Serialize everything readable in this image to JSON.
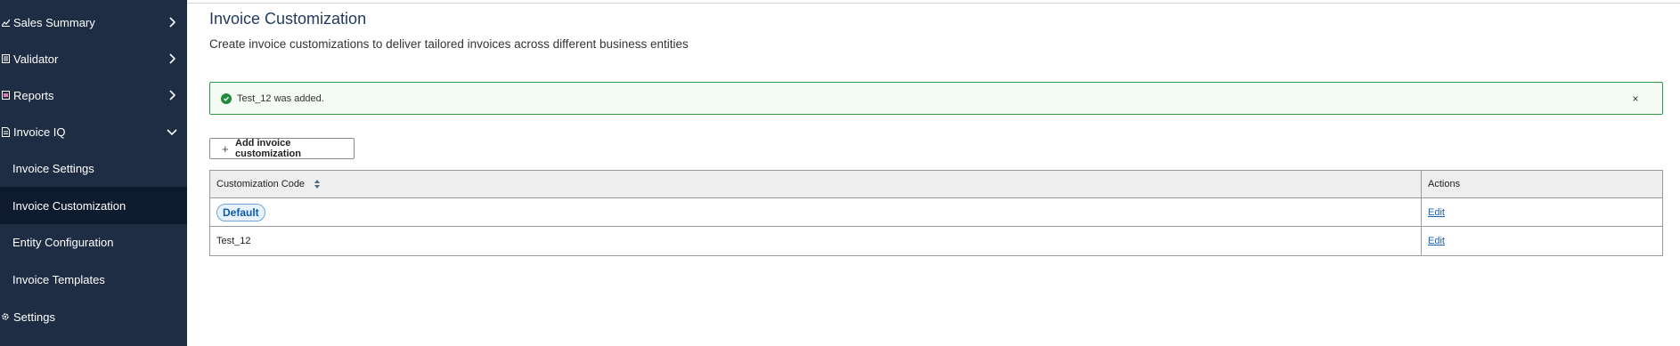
{
  "sidebar": {
    "items": [
      {
        "label": "Sales Summary",
        "icon": "chart-icon"
      },
      {
        "label": "Validator",
        "icon": "validator-icon"
      },
      {
        "label": "Reports",
        "icon": "reports-icon"
      },
      {
        "label": "Invoice IQ",
        "icon": "invoice-icon"
      },
      {
        "label": "Invoice Settings"
      },
      {
        "label": "Invoice Customization"
      },
      {
        "label": "Entity Configuration"
      },
      {
        "label": "Invoice Templates"
      },
      {
        "label": "Settings",
        "icon": "gear-icon"
      }
    ],
    "active_item": "Invoice Customization"
  },
  "main": {
    "title": "Invoice Customization",
    "subtitle": "Create invoice customizations to deliver tailored invoices across different business entities",
    "alert": {
      "message": "Test_12 was added.",
      "close_glyph": "×",
      "status": "success"
    },
    "add_button_label": "Add invoice customization",
    "table": {
      "headers": {
        "code": "Customization Code",
        "actions": "Actions"
      },
      "rows": [
        {
          "code": "Default",
          "badge": true,
          "action": "Edit"
        },
        {
          "code": "Test_12",
          "badge": false,
          "action": "Edit"
        }
      ]
    }
  },
  "colors": {
    "sidebar_bg": "#1f2d44",
    "sidebar_active_bg": "#0e1a2d",
    "title": "#1e3a5f",
    "success": "#2e9b48",
    "link": "#1a5fb4"
  }
}
